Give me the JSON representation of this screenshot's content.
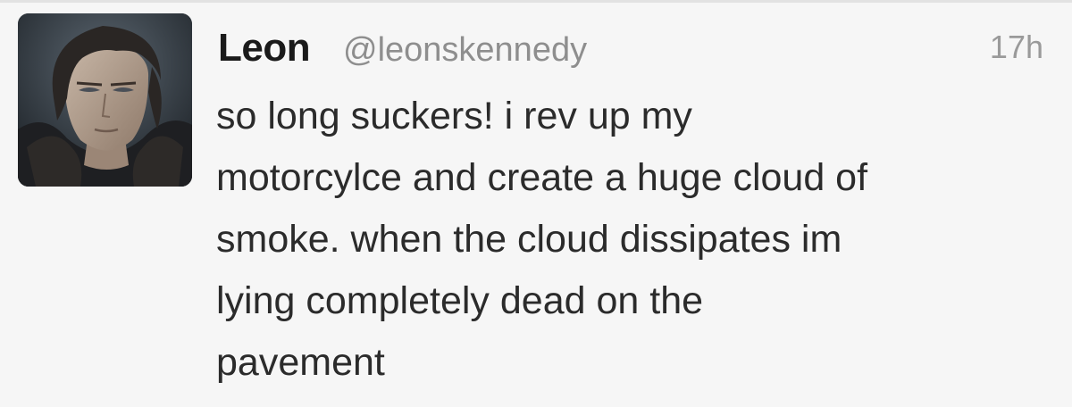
{
  "tweet": {
    "author": {
      "name": "Leon",
      "handle": "@leonskennedy",
      "avatar_icon": "user-avatar-photo"
    },
    "timestamp": "17h",
    "text_lines": [
      "so long suckers! i rev up my",
      "motorcylce and create a huge cloud of",
      "smoke. when the cloud dissipates im",
      "lying completely dead on the",
      "pavement"
    ]
  },
  "colors": {
    "background": "#f6f6f6",
    "name": "#1a1a1a",
    "handle": "#8e8e8e",
    "timestamp": "#9a9a9a",
    "body_text": "#2b2b2b"
  }
}
